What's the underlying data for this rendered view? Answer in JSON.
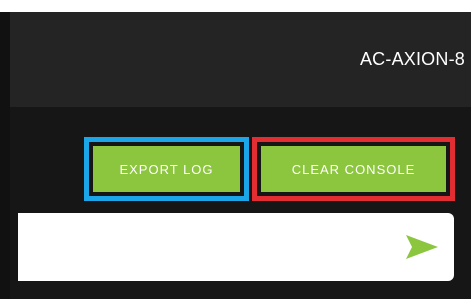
{
  "header": {
    "device_name": "AC-AXION-8"
  },
  "actions": {
    "export_label": "EXPORT LOG",
    "clear_label": "CLEAR CONSOLE"
  },
  "command": {
    "value": "",
    "placeholder": ""
  },
  "colors": {
    "accent_green": "#8cc63f",
    "highlight_blue": "#1aa6e8",
    "highlight_red": "#e22d33"
  },
  "icons": {
    "send": "send-arrow-icon"
  }
}
